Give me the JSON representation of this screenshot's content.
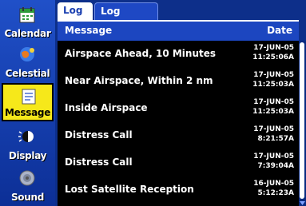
{
  "sidebar": {
    "items": [
      {
        "label": "Calendar",
        "icon": "calendar-icon"
      },
      {
        "label": "Celestial",
        "icon": "celestial-icon"
      },
      {
        "label": "Message",
        "icon": "message-icon",
        "selected": true
      },
      {
        "label": "Display",
        "icon": "display-icon"
      },
      {
        "label": "Sound",
        "icon": "sound-icon"
      }
    ]
  },
  "tabs": [
    {
      "label": "Log",
      "active": true
    },
    {
      "label": "Log Filter",
      "active": false
    }
  ],
  "table": {
    "columns": {
      "message": "Message",
      "date": "Date"
    },
    "rows": [
      {
        "message": "Airspace Ahead, 10 Minutes",
        "date": "17-JUN-05",
        "time": "11:25:06A"
      },
      {
        "message": "Near Airspace, Within 2 nm",
        "date": "17-JUN-05",
        "time": "11:25:03A"
      },
      {
        "message": "Inside Airspace",
        "date": "17-JUN-05",
        "time": "11:25:03A"
      },
      {
        "message": "Distress Call",
        "date": "17-JUN-05",
        "time": "8:21:57A"
      },
      {
        "message": "Distress Call",
        "date": "17-JUN-05",
        "time": "7:39:04A"
      },
      {
        "message": "Lost Satellite Reception",
        "date": "16-JUN-05",
        "time": "5:12:23A"
      }
    ]
  },
  "colors": {
    "background": "#0d2f8a",
    "selected": "#f6e81a",
    "header": "#1c46c0",
    "list_background": "#000000"
  }
}
